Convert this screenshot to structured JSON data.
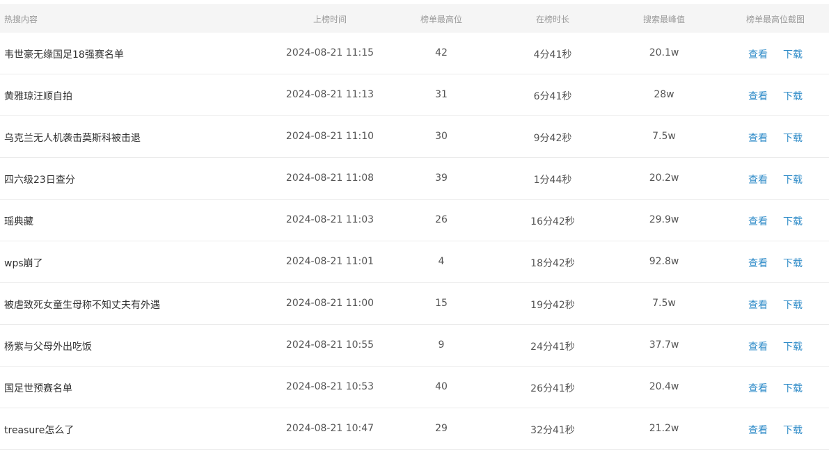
{
  "table": {
    "columns": [
      "热搜内容",
      "上榜时间",
      "榜单最高位",
      "在榜时长",
      "搜索最峰值",
      "榜单最高位截图"
    ],
    "view_label": "查看",
    "download_label": "下载",
    "rows": [
      {
        "title": "韦世豪无缘国足18强赛名单",
        "time": "2024-08-21 11:15",
        "rank": "42",
        "duration": "4分41秒",
        "peak": "20.1w"
      },
      {
        "title": "黄雅琼汪顺自拍",
        "time": "2024-08-21 11:13",
        "rank": "31",
        "duration": "6分41秒",
        "peak": "28w"
      },
      {
        "title": "乌克兰无人机袭击莫斯科被击退",
        "time": "2024-08-21 11:10",
        "rank": "30",
        "duration": "9分42秒",
        "peak": "7.5w"
      },
      {
        "title": "四六级23日查分",
        "time": "2024-08-21 11:08",
        "rank": "39",
        "duration": "1分44秒",
        "peak": "20.2w"
      },
      {
        "title": "瑶典藏",
        "time": "2024-08-21 11:03",
        "rank": "26",
        "duration": "16分42秒",
        "peak": "29.9w"
      },
      {
        "title": "wps崩了",
        "time": "2024-08-21 11:01",
        "rank": "4",
        "duration": "18分42秒",
        "peak": "92.8w"
      },
      {
        "title": "被虐致死女童生母称不知丈夫有外遇",
        "time": "2024-08-21 11:00",
        "rank": "15",
        "duration": "19分42秒",
        "peak": "7.5w"
      },
      {
        "title": "杨紫与父母外出吃饭",
        "time": "2024-08-21 10:55",
        "rank": "9",
        "duration": "24分41秒",
        "peak": "37.7w"
      },
      {
        "title": "国足世预赛名单",
        "time": "2024-08-21 10:53",
        "rank": "40",
        "duration": "26分41秒",
        "peak": "20.4w"
      },
      {
        "title": "treasure怎么了",
        "time": "2024-08-21 10:47",
        "rank": "29",
        "duration": "32分41秒",
        "peak": "21.2w"
      }
    ]
  }
}
